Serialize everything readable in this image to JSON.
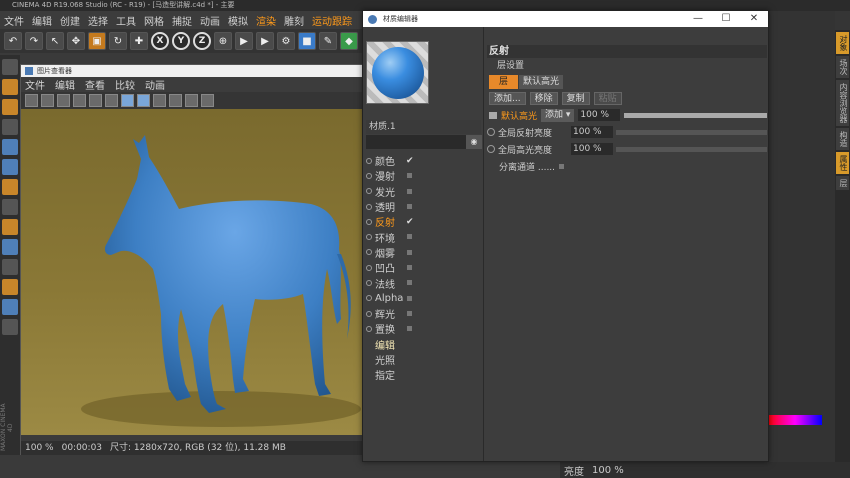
{
  "app": {
    "title": "CINEMA 4D R19.068 Studio (RC - R19) - [马造型讲解.c4d *] - 主要",
    "menu": [
      {
        "label": "文件",
        "hl": false
      },
      {
        "label": "编辑",
        "hl": false
      },
      {
        "label": "创建",
        "hl": false
      },
      {
        "label": "选择",
        "hl": false
      },
      {
        "label": "工具",
        "hl": false
      },
      {
        "label": "网格",
        "hl": false
      },
      {
        "label": "捕捉",
        "hl": false
      },
      {
        "label": "动画",
        "hl": false
      },
      {
        "label": "模拟",
        "hl": false
      },
      {
        "label": "渲染",
        "hl": true
      },
      {
        "label": "雕刻",
        "hl": false
      },
      {
        "label": "运动跟踪",
        "hl": true
      }
    ],
    "right_tabs": [
      "对象",
      "场次",
      "内容浏览器",
      "构造",
      "属性",
      "层"
    ],
    "bottom_label": "亮度",
    "bottom_value": "100 %",
    "maxon_text": "MAXON CINEMA 4D"
  },
  "viewer": {
    "title": "图片查看器",
    "menu": [
      "文件",
      "编辑",
      "查看",
      "比较",
      "动画"
    ],
    "status": {
      "zoom": "100 %",
      "time": "00:00:03",
      "info": "尺寸: 1280x720, RGB (32 位), 11.28 MB"
    },
    "colors": {
      "background": "#8a7836",
      "horse": "#3d7fc4"
    }
  },
  "material_editor": {
    "title": "材质编辑器",
    "material_name": "材质.1",
    "channels": [
      {
        "label": "颜色",
        "state": "check",
        "active": false
      },
      {
        "label": "漫射",
        "state": "box",
        "active": false
      },
      {
        "label": "发光",
        "state": "box",
        "active": false
      },
      {
        "label": "透明",
        "state": "box",
        "active": false
      },
      {
        "label": "反射",
        "state": "check",
        "active": true
      },
      {
        "label": "环境",
        "state": "box",
        "active": false
      },
      {
        "label": "烟雾",
        "state": "box",
        "active": false
      },
      {
        "label": "凹凸",
        "state": "box",
        "active": false
      },
      {
        "label": "法线",
        "state": "box",
        "active": false
      },
      {
        "label": "Alpha",
        "state": "box",
        "active": false
      },
      {
        "label": "辉光",
        "state": "box",
        "active": false
      },
      {
        "label": "置换",
        "state": "box",
        "active": false
      }
    ],
    "extra_items": [
      "编辑",
      "光照",
      "指定"
    ],
    "section_title": "反射",
    "layer_settings": "层设置",
    "tabs": [
      "层",
      "默认高光"
    ],
    "buttons": {
      "add": "添加...",
      "remove": "移除",
      "copy": "复制",
      "paste": "粘贴"
    },
    "layer": {
      "name": "默认高光",
      "mode": "添加",
      "opacity": "100 %",
      "opacity_fraction": 1.0
    },
    "global_reflection": {
      "label": "全局反射亮度",
      "value": "100 %",
      "fraction": 0.0
    },
    "global_specular": {
      "label": "全局高光亮度",
      "value": "100 %",
      "fraction": 0.0
    },
    "separate_pass": "分离通道 ......"
  }
}
